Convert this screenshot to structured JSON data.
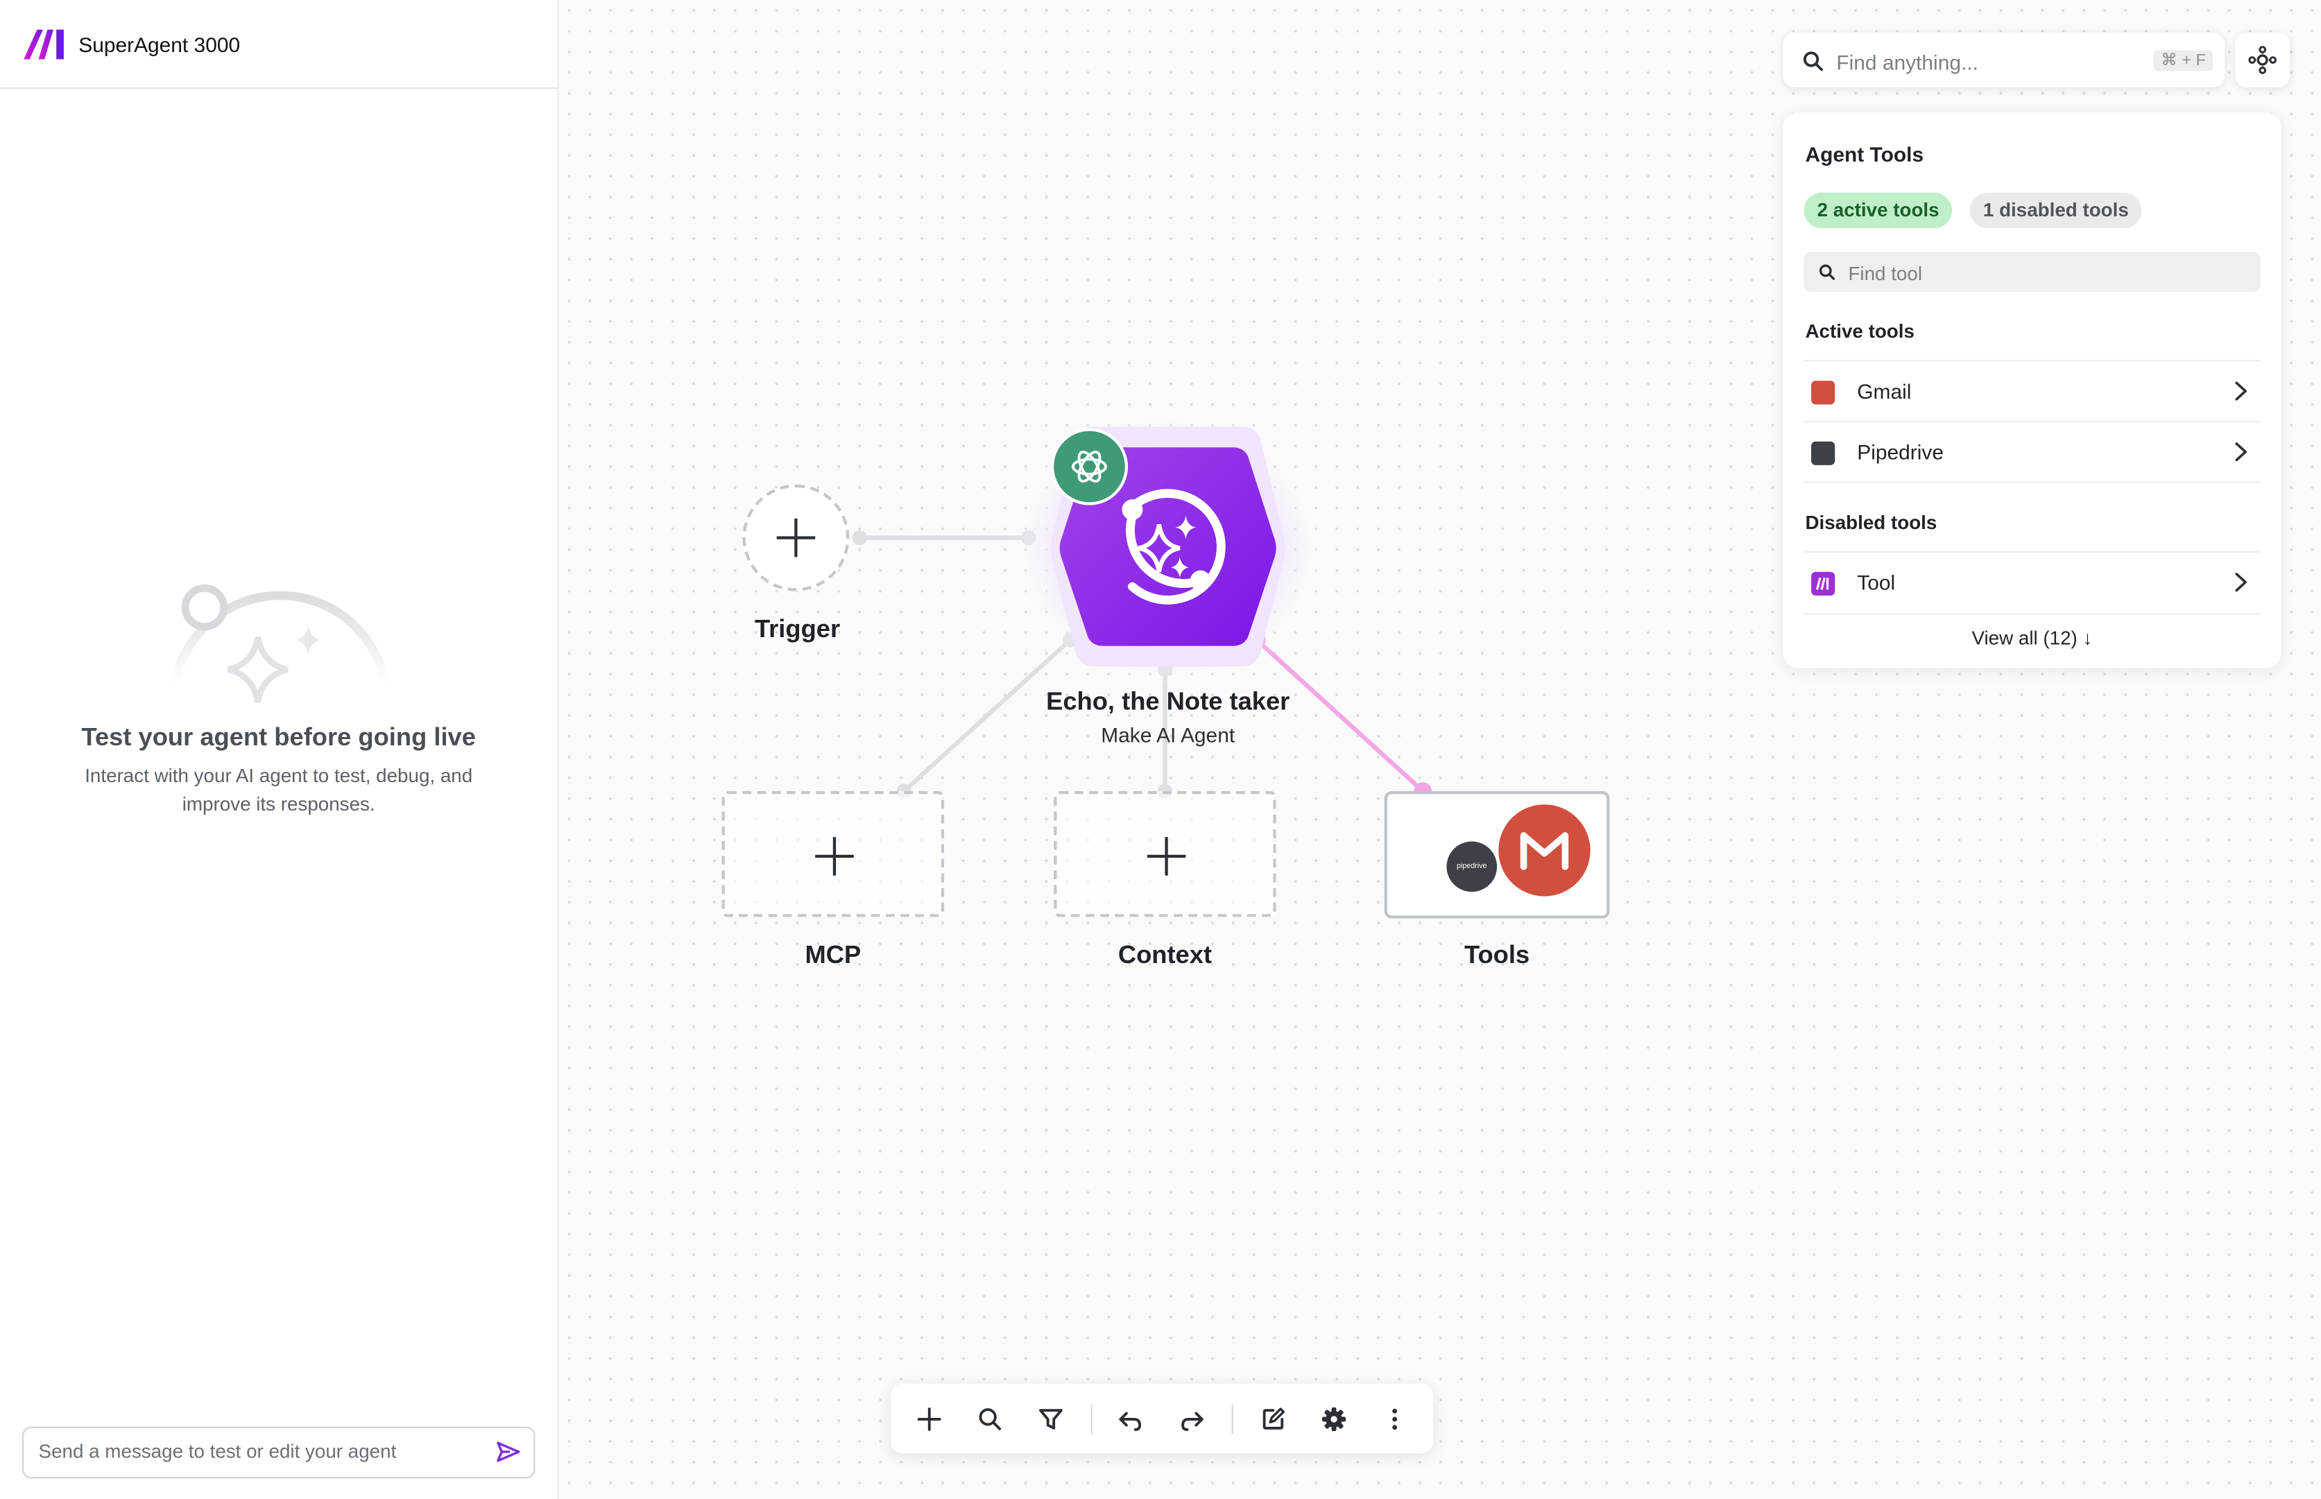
{
  "app": {
    "title": "SuperAgent 3000"
  },
  "chat": {
    "empty_title": "Test your agent before going live",
    "empty_subtitle": "Interact with your AI agent to test, debug, and improve its responses.",
    "input_placeholder": "Send a message to test or edit your agent"
  },
  "canvas": {
    "nodes": {
      "trigger": "Trigger",
      "agent_title": "Echo, the Note taker",
      "agent_subtitle": "Make AI Agent",
      "mcp": "MCP",
      "context": "Context",
      "tools": "Tools",
      "pipedrive_badge": "pipedrive"
    }
  },
  "search": {
    "placeholder": "Find anything...",
    "shortcut": "⌘ + F"
  },
  "tools_panel": {
    "title": "Agent Tools",
    "active_chip": "2 active tools",
    "disabled_chip": "1 disabled tools",
    "find_placeholder": "Find tool",
    "active_label": "Active tools",
    "active": [
      {
        "name": "Gmail",
        "color": "#d14f3f"
      },
      {
        "name": "Pipedrive",
        "color": "#3d4147"
      }
    ],
    "disabled_label": "Disabled tools",
    "disabled": [
      {
        "name": "Tool",
        "color": "#9b2fd6"
      }
    ],
    "view_all": "View all (12) ↓"
  },
  "colors": {
    "brand": "#8a2be2",
    "agent_node": "#8b22e8",
    "openai_badge": "#3f9a76",
    "tools_connector": "#f3a6e6",
    "active_chip_bg": "#bfefc9"
  },
  "toolbar": {
    "icons": [
      "plus-icon",
      "search-icon",
      "filter-icon",
      "undo-icon",
      "redo-icon",
      "edit-icon",
      "gear-icon",
      "more-vertical-icon"
    ]
  }
}
